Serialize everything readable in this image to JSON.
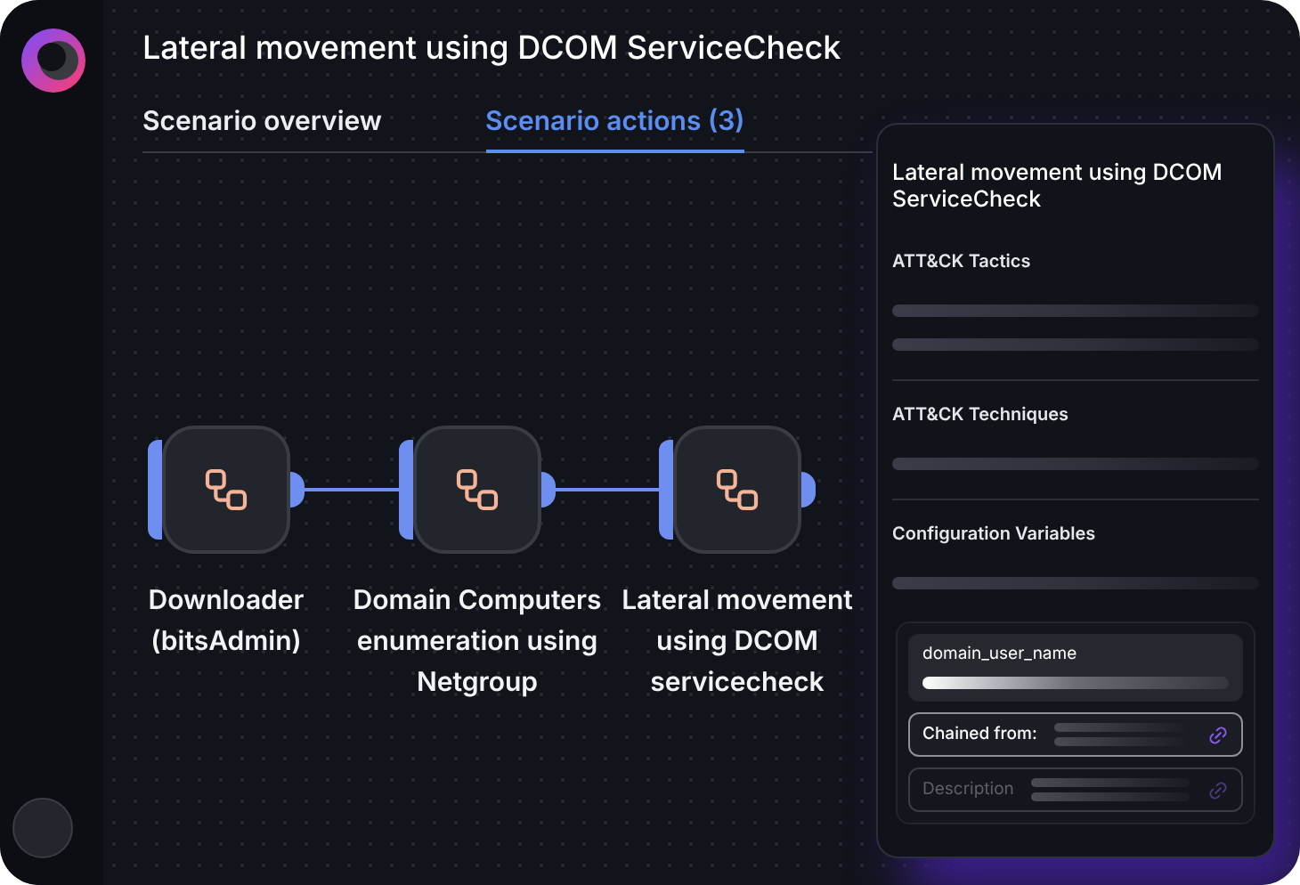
{
  "window": {
    "title": "Lateral movement using DCOM ServiceCheck"
  },
  "tabs": [
    {
      "label": "Scenario overview",
      "selected": false
    },
    {
      "label": "Scenario actions (3)",
      "selected": true
    }
  ],
  "actions": [
    {
      "label": "Downloader (bitsAdmin)"
    },
    {
      "label": "Domain Computers enumeration using Netgroup"
    },
    {
      "label": "Lateral movement using DCOM servicecheck"
    }
  ],
  "panel": {
    "title": "Lateral movement using DCOM ServiceCheck",
    "sections": [
      {
        "heading": "ATT&CK Tactics",
        "kind": "double"
      },
      {
        "heading": "ATT&CK Techniques",
        "kind": "single"
      },
      {
        "heading": "Configuration Variables",
        "kind": "single"
      }
    ],
    "variable": {
      "name": "domain_user_name",
      "fields": [
        {
          "label": "Chained from:",
          "disabled": false
        },
        {
          "label": "Description",
          "disabled": true
        }
      ]
    }
  }
}
